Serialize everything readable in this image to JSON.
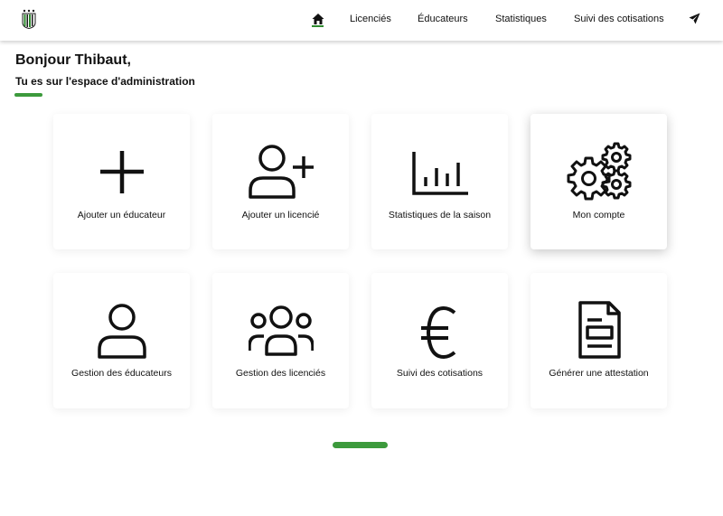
{
  "nav": {
    "items": [
      {
        "label": "Licenciés"
      },
      {
        "label": "Éducateurs"
      },
      {
        "label": "Statistiques"
      },
      {
        "label": "Suivi des cotisations"
      }
    ],
    "home_icon": "home-icon",
    "send_icon": "paper-plane-icon",
    "active": "home"
  },
  "header": {
    "greeting": "Bonjour Thibaut,",
    "subtitle": "Tu es sur l'espace d'administration"
  },
  "cards": [
    {
      "label": "Ajouter un éducateur",
      "icon": "plus-icon"
    },
    {
      "label": "Ajouter un licencié",
      "icon": "add-user-icon"
    },
    {
      "label": "Statistiques de la saison",
      "icon": "bar-chart-icon"
    },
    {
      "label": "Mon compte",
      "icon": "gears-icon"
    },
    {
      "label": "Gestion des éducateurs",
      "icon": "user-icon"
    },
    {
      "label": "Gestion des licenciés",
      "icon": "users-group-icon"
    },
    {
      "label": "Suivi des cotisations",
      "icon": "euro-icon"
    },
    {
      "label": "Générer une attestation",
      "icon": "document-icon"
    }
  ],
  "colors": {
    "accent": "#3c9a3c",
    "text": "#111111",
    "background": "#ffffff"
  }
}
